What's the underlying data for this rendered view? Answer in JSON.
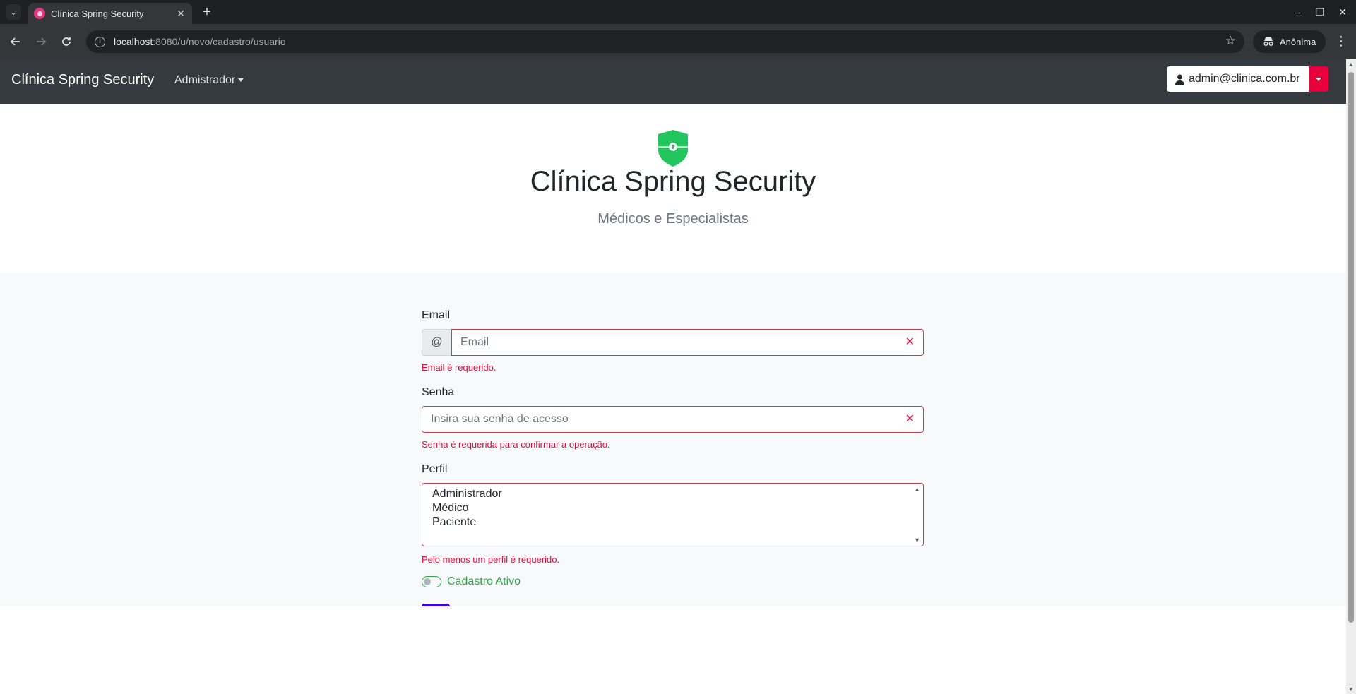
{
  "browser": {
    "tab_title": "Clínica Spring Security",
    "url_host": "localhost",
    "url_path": ":8080/u/novo/cadastro/usuario",
    "profile_label": "Anônima"
  },
  "navbar": {
    "brand": "Clínica Spring Security",
    "menu_label": "Admistrador",
    "user_email": "admin@clinica.com.br"
  },
  "hero": {
    "title": "Clínica Spring Security",
    "subtitle": "Médicos e Especialistas"
  },
  "form": {
    "email": {
      "label": "Email",
      "addon": "@",
      "placeholder": "Email",
      "value": "",
      "error": "Email é requerido."
    },
    "senha": {
      "label": "Senha",
      "placeholder": "Insira sua senha de acesso",
      "value": "",
      "error": "Senha é requerida para confirmar a operação."
    },
    "perfil": {
      "label": "Perfil",
      "options": [
        "Administrador",
        "Médico",
        "Paciente"
      ],
      "error": "Pelo menos um perfil é requerido."
    },
    "ativo": {
      "label": "Cadastro Ativo",
      "checked": false
    }
  },
  "colors": {
    "navbar_bg": "#343a40",
    "error": "#dc0d3c",
    "success": "#28a745",
    "primary_button": "#3d00e8",
    "user_caret": "#e8003d",
    "shield": "#22c55e"
  },
  "icons": {
    "logo": "shield-icon",
    "user": "user-icon",
    "save": "save-icon",
    "invalid": "x-icon"
  }
}
